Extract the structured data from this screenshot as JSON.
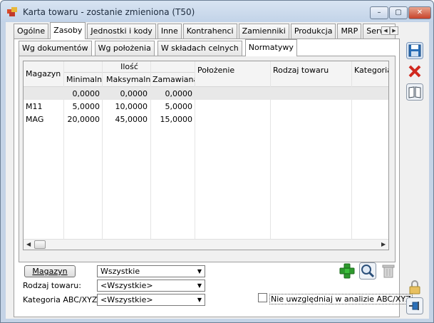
{
  "window": {
    "title": "Karta towaru - zostanie zmieniona (T50)",
    "min_label": "–",
    "max_label": "▢",
    "close_label": "✕"
  },
  "main_tabs": [
    "Ogólne",
    "Zasoby",
    "Jednostki i kody",
    "Inne",
    "Kontrahenci",
    "Zamienniki",
    "Produkcja",
    "MRP",
    "Serwis"
  ],
  "main_tabs_active": "Zasoby",
  "sub_tabs": [
    "Wg dokumentów",
    "Wg położenia",
    "W składach celnych",
    "Normatywy"
  ],
  "sub_tabs_active": "Normatywy",
  "grid": {
    "headers": {
      "magazyn": "Magazyn",
      "ilosc": "Ilość",
      "minimalna": "Minimalna",
      "maksymalna": "Maksymalna",
      "zamawiana": "Zamawiana",
      "polozenie": "Położenie",
      "rodzaj": "Rodzaj towaru",
      "kategoria": "Kategoria ABC"
    },
    "rows": [
      {
        "magazyn": "",
        "min": "0,0000",
        "max": "0,0000",
        "zam": "0,0000"
      },
      {
        "magazyn": "M11",
        "min": "5,0000",
        "max": "10,0000",
        "zam": "5,0000"
      },
      {
        "magazyn": "MAG",
        "min": "20,0000",
        "max": "45,0000",
        "zam": "15,0000"
      }
    ]
  },
  "filters": {
    "magazyn_button": "Magazyn",
    "magazyn_value": "Wszystkie",
    "rodzaj_label": "Rodzaj towaru:",
    "rodzaj_value": "<Wszystkie>",
    "kategoria_label": "Kategoria ABC/XYZ:",
    "kategoria_value": "<Wszystkie>",
    "checkbox_label": "Nie uwzględniaj w analizie ABC/XYZ",
    "checkbox_checked": false
  },
  "colors": {
    "accent": "#2a6fb8",
    "add_green": "#2e9a2e",
    "delete_red": "#d0281e"
  }
}
